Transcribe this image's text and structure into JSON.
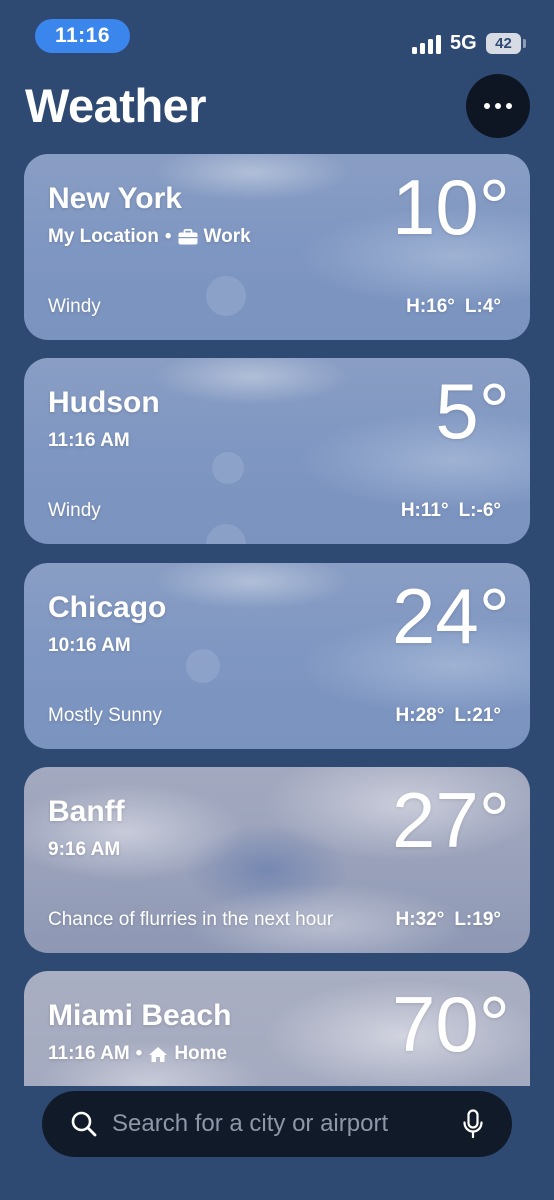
{
  "status_bar": {
    "time": "11:16",
    "network": "5G",
    "battery": "42",
    "colors": {
      "time_pill": "#3a86ec"
    }
  },
  "header": {
    "title": "Weather",
    "more_icon": "ellipsis-icon"
  },
  "cities": [
    {
      "name": "New York",
      "subtitle": "My Location",
      "tag_icon": "briefcase-icon",
      "tag": "Work",
      "temp": "10°",
      "condition": "Windy",
      "high": "H:16°",
      "low": "L:4°"
    },
    {
      "name": "Hudson",
      "subtitle": "11:16 AM",
      "temp": "5°",
      "condition": "Windy",
      "high": "H:11°",
      "low": "L:-6°"
    },
    {
      "name": "Chicago",
      "subtitle": "10:16 AM",
      "temp": "24°",
      "condition": "Mostly Sunny",
      "high": "H:28°",
      "low": "L:21°"
    },
    {
      "name": "Banff",
      "subtitle": "9:16 AM",
      "temp": "27°",
      "condition": "Chance of flurries in the next hour",
      "high": "H:32°",
      "low": "L:19°"
    },
    {
      "name": "Miami Beach",
      "subtitle": "11:16 AM",
      "tag_icon": "house-icon",
      "tag": "Home",
      "temp": "70°"
    }
  ],
  "search": {
    "placeholder": "Search for a city or airport",
    "search_icon": "search-icon",
    "mic_icon": "microphone-icon"
  },
  "colors": {
    "background": "#2f4a72",
    "search_bar": "#111a29",
    "more_button": "#0e1623"
  }
}
